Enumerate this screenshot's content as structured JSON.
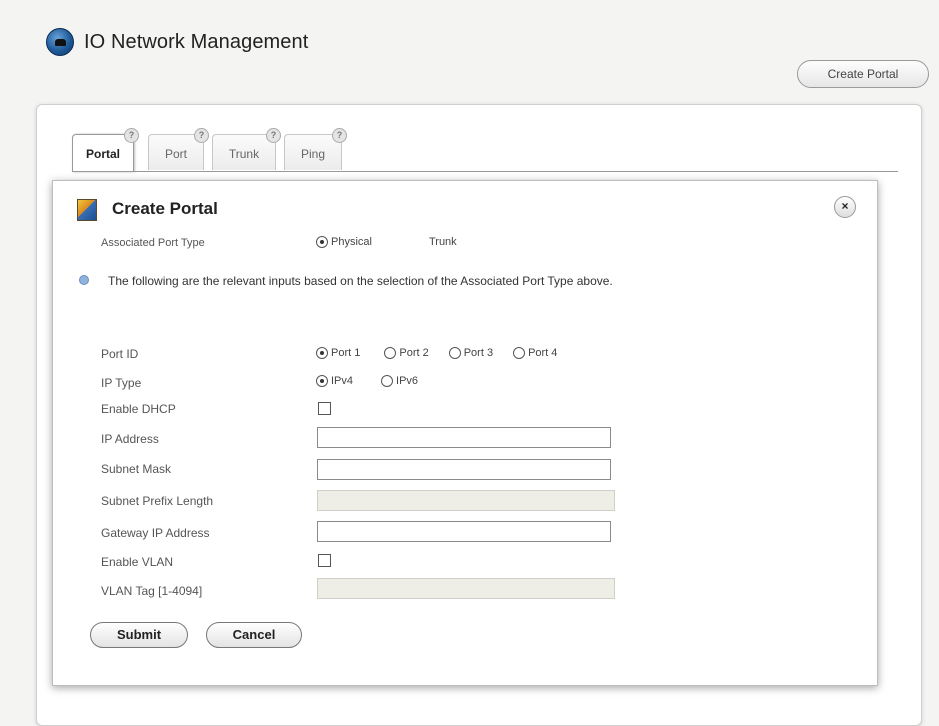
{
  "header": {
    "title": "IO Network Management",
    "create_portal_label": "Create Portal"
  },
  "tabs": [
    {
      "label": "Portal",
      "help": "?"
    },
    {
      "label": "Port",
      "help": "?"
    },
    {
      "label": "Trunk",
      "help": "?"
    },
    {
      "label": "Ping",
      "help": "?"
    }
  ],
  "dialog": {
    "title": "Create Portal",
    "close_glyph": "×",
    "associated_port_type": {
      "label": "Associated Port Type",
      "options": [
        "Physical",
        "Trunk"
      ],
      "selected": "Physical"
    },
    "info_text": "The following are the relevant inputs based on the selection of the Associated Port Type above.",
    "port_id": {
      "label": "Port ID",
      "options": [
        "Port 1",
        "Port 2",
        "Port 3",
        "Port 4"
      ],
      "selected": "Port 1"
    },
    "ip_type": {
      "label": "IP Type",
      "options": [
        "IPv4",
        "IPv6"
      ],
      "selected": "IPv4"
    },
    "enable_dhcp": {
      "label": "Enable DHCP",
      "checked": false
    },
    "ip_address": {
      "label": "IP Address",
      "value": ""
    },
    "subnet_mask": {
      "label": "Subnet Mask",
      "value": ""
    },
    "subnet_prefix_length": {
      "label": "Subnet Prefix Length",
      "value": "",
      "disabled": true
    },
    "gateway_ip_address": {
      "label": "Gateway IP Address",
      "value": ""
    },
    "enable_vlan": {
      "label": "Enable VLAN",
      "checked": false
    },
    "vlan_tag": {
      "label": "VLAN Tag [1-4094]",
      "value": "",
      "disabled": true
    },
    "submit_label": "Submit",
    "cancel_label": "Cancel"
  }
}
